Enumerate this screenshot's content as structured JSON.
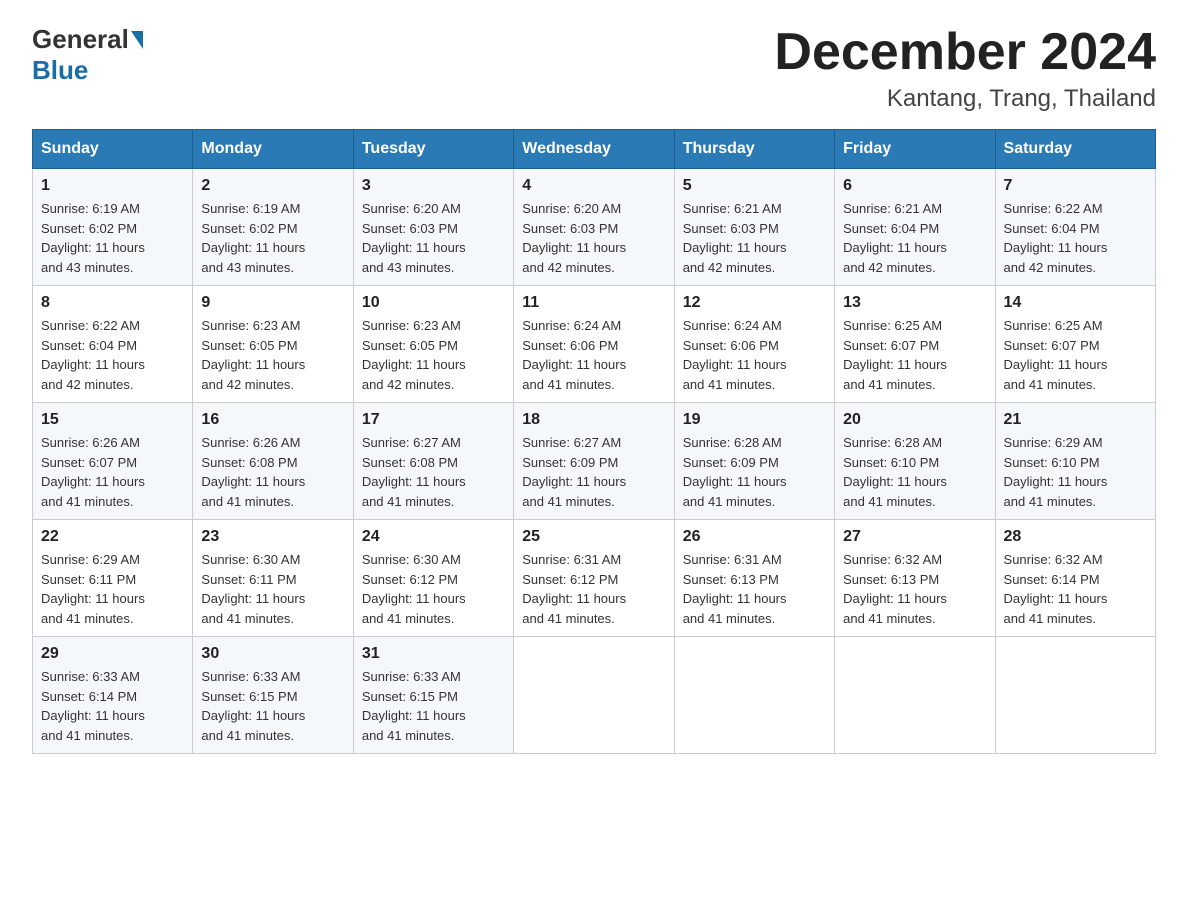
{
  "logo": {
    "general": "General",
    "blue": "Blue"
  },
  "header": {
    "month": "December 2024",
    "location": "Kantang, Trang, Thailand"
  },
  "weekdays": [
    "Sunday",
    "Monday",
    "Tuesday",
    "Wednesday",
    "Thursday",
    "Friday",
    "Saturday"
  ],
  "weeks": [
    [
      {
        "day": "1",
        "sunrise": "6:19 AM",
        "sunset": "6:02 PM",
        "daylight": "11 hours and 43 minutes."
      },
      {
        "day": "2",
        "sunrise": "6:19 AM",
        "sunset": "6:02 PM",
        "daylight": "11 hours and 43 minutes."
      },
      {
        "day": "3",
        "sunrise": "6:20 AM",
        "sunset": "6:03 PM",
        "daylight": "11 hours and 43 minutes."
      },
      {
        "day": "4",
        "sunrise": "6:20 AM",
        "sunset": "6:03 PM",
        "daylight": "11 hours and 42 minutes."
      },
      {
        "day": "5",
        "sunrise": "6:21 AM",
        "sunset": "6:03 PM",
        "daylight": "11 hours and 42 minutes."
      },
      {
        "day": "6",
        "sunrise": "6:21 AM",
        "sunset": "6:04 PM",
        "daylight": "11 hours and 42 minutes."
      },
      {
        "day": "7",
        "sunrise": "6:22 AM",
        "sunset": "6:04 PM",
        "daylight": "11 hours and 42 minutes."
      }
    ],
    [
      {
        "day": "8",
        "sunrise": "6:22 AM",
        "sunset": "6:04 PM",
        "daylight": "11 hours and 42 minutes."
      },
      {
        "day": "9",
        "sunrise": "6:23 AM",
        "sunset": "6:05 PM",
        "daylight": "11 hours and 42 minutes."
      },
      {
        "day": "10",
        "sunrise": "6:23 AM",
        "sunset": "6:05 PM",
        "daylight": "11 hours and 42 minutes."
      },
      {
        "day": "11",
        "sunrise": "6:24 AM",
        "sunset": "6:06 PM",
        "daylight": "11 hours and 41 minutes."
      },
      {
        "day": "12",
        "sunrise": "6:24 AM",
        "sunset": "6:06 PM",
        "daylight": "11 hours and 41 minutes."
      },
      {
        "day": "13",
        "sunrise": "6:25 AM",
        "sunset": "6:07 PM",
        "daylight": "11 hours and 41 minutes."
      },
      {
        "day": "14",
        "sunrise": "6:25 AM",
        "sunset": "6:07 PM",
        "daylight": "11 hours and 41 minutes."
      }
    ],
    [
      {
        "day": "15",
        "sunrise": "6:26 AM",
        "sunset": "6:07 PM",
        "daylight": "11 hours and 41 minutes."
      },
      {
        "day": "16",
        "sunrise": "6:26 AM",
        "sunset": "6:08 PM",
        "daylight": "11 hours and 41 minutes."
      },
      {
        "day": "17",
        "sunrise": "6:27 AM",
        "sunset": "6:08 PM",
        "daylight": "11 hours and 41 minutes."
      },
      {
        "day": "18",
        "sunrise": "6:27 AM",
        "sunset": "6:09 PM",
        "daylight": "11 hours and 41 minutes."
      },
      {
        "day": "19",
        "sunrise": "6:28 AM",
        "sunset": "6:09 PM",
        "daylight": "11 hours and 41 minutes."
      },
      {
        "day": "20",
        "sunrise": "6:28 AM",
        "sunset": "6:10 PM",
        "daylight": "11 hours and 41 minutes."
      },
      {
        "day": "21",
        "sunrise": "6:29 AM",
        "sunset": "6:10 PM",
        "daylight": "11 hours and 41 minutes."
      }
    ],
    [
      {
        "day": "22",
        "sunrise": "6:29 AM",
        "sunset": "6:11 PM",
        "daylight": "11 hours and 41 minutes."
      },
      {
        "day": "23",
        "sunrise": "6:30 AM",
        "sunset": "6:11 PM",
        "daylight": "11 hours and 41 minutes."
      },
      {
        "day": "24",
        "sunrise": "6:30 AM",
        "sunset": "6:12 PM",
        "daylight": "11 hours and 41 minutes."
      },
      {
        "day": "25",
        "sunrise": "6:31 AM",
        "sunset": "6:12 PM",
        "daylight": "11 hours and 41 minutes."
      },
      {
        "day": "26",
        "sunrise": "6:31 AM",
        "sunset": "6:13 PM",
        "daylight": "11 hours and 41 minutes."
      },
      {
        "day": "27",
        "sunrise": "6:32 AM",
        "sunset": "6:13 PM",
        "daylight": "11 hours and 41 minutes."
      },
      {
        "day": "28",
        "sunrise": "6:32 AM",
        "sunset": "6:14 PM",
        "daylight": "11 hours and 41 minutes."
      }
    ],
    [
      {
        "day": "29",
        "sunrise": "6:33 AM",
        "sunset": "6:14 PM",
        "daylight": "11 hours and 41 minutes."
      },
      {
        "day": "30",
        "sunrise": "6:33 AM",
        "sunset": "6:15 PM",
        "daylight": "11 hours and 41 minutes."
      },
      {
        "day": "31",
        "sunrise": "6:33 AM",
        "sunset": "6:15 PM",
        "daylight": "11 hours and 41 minutes."
      },
      null,
      null,
      null,
      null
    ]
  ],
  "labels": {
    "sunrise": "Sunrise:",
    "sunset": "Sunset:",
    "daylight": "Daylight:"
  }
}
